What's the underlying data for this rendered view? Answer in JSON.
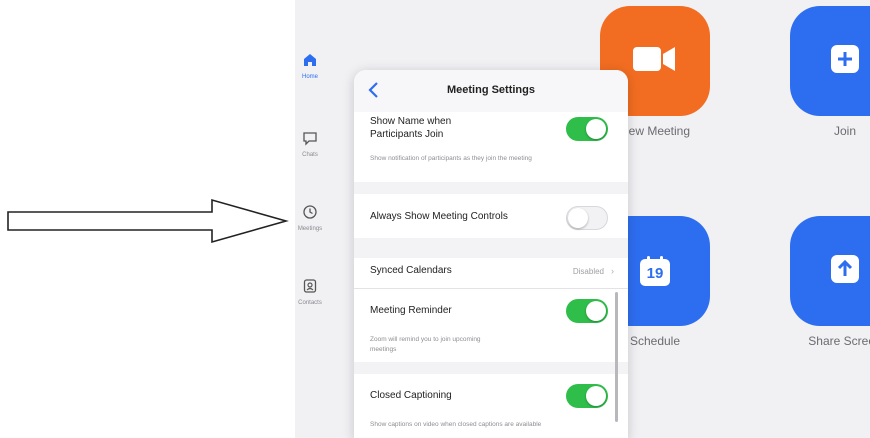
{
  "sidebar": {
    "items": [
      {
        "label": "Home",
        "icon": "home-icon"
      },
      {
        "label": "Chats",
        "icon": "chat-icon"
      },
      {
        "label": "Meetings",
        "icon": "clock-icon"
      },
      {
        "label": "Contacts",
        "icon": "contact-icon"
      }
    ]
  },
  "tiles": {
    "new_meeting": "New Meeting",
    "join": "Join",
    "schedule": "Schedule",
    "share_screen": "Share Screen",
    "calendar_day": "19"
  },
  "panel": {
    "title": "Meeting Settings",
    "show_name": {
      "title_line1": "Show Name when",
      "title_line2": "Participants Join",
      "subtitle": "Show notification of participants as they join the meeting",
      "enabled": true
    },
    "always_show_controls": {
      "title": "Always Show Meeting Controls",
      "enabled": false
    },
    "synced_calendars": {
      "title": "Synced Calendars",
      "value": "Disabled"
    },
    "meeting_reminder": {
      "title": "Meeting Reminder",
      "subtitle": "Zoom will remind you to join upcoming meetings",
      "enabled": true
    },
    "closed_captioning": {
      "title": "Closed Captioning",
      "subtitle": "Show captions on video when closed captions are available",
      "enabled": true
    }
  },
  "colors": {
    "orange": "#f26d21",
    "blue": "#2d6ef0",
    "toggle_on": "#2fbe4a",
    "accent": "#2d6ef0"
  }
}
